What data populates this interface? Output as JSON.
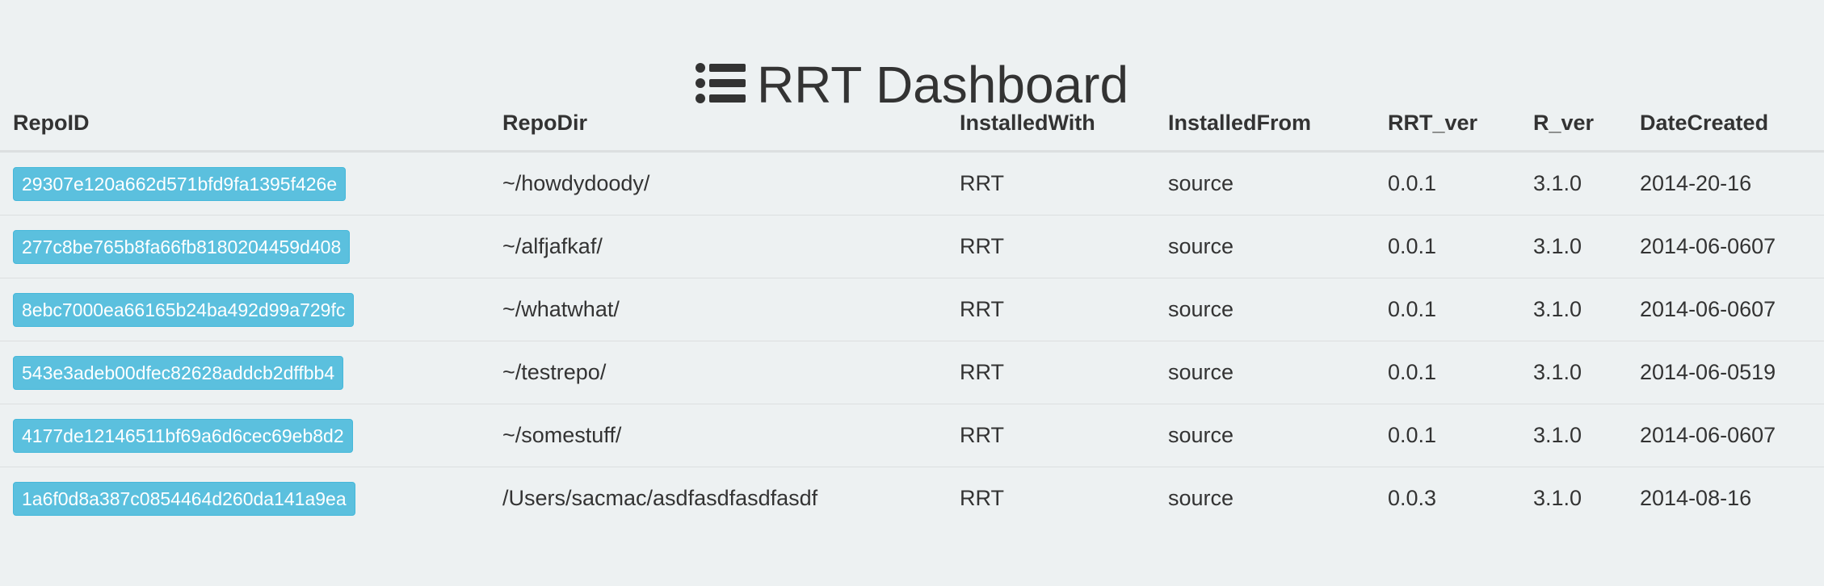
{
  "header": {
    "title": "RRT Dashboard",
    "icon": "list-icon"
  },
  "table": {
    "columns": [
      "RepoID",
      "RepoDir",
      "InstalledWith",
      "InstalledFrom",
      "RRT_ver",
      "R_ver",
      "DateCreated"
    ],
    "rows": [
      {
        "repo_id": "29307e120a662d571bfd9fa1395f426e",
        "repo_dir": "~/howdydoody/",
        "installed_with": "RRT",
        "installed_from": "source",
        "rrt_ver": "0.0.1",
        "r_ver": "3.1.0",
        "date_created": "2014-20-16"
      },
      {
        "repo_id": "277c8be765b8fa66fb8180204459d408",
        "repo_dir": "~/alfjafkaf/",
        "installed_with": "RRT",
        "installed_from": "source",
        "rrt_ver": "0.0.1",
        "r_ver": "3.1.0",
        "date_created": "2014-06-0607"
      },
      {
        "repo_id": "8ebc7000ea66165b24ba492d99a729fc",
        "repo_dir": "~/whatwhat/",
        "installed_with": "RRT",
        "installed_from": "source",
        "rrt_ver": "0.0.1",
        "r_ver": "3.1.0",
        "date_created": "2014-06-0607"
      },
      {
        "repo_id": "543e3adeb00dfec82628addcb2dffbb4",
        "repo_dir": "~/testrepo/",
        "installed_with": "RRT",
        "installed_from": "source",
        "rrt_ver": "0.0.1",
        "r_ver": "3.1.0",
        "date_created": "2014-06-0519"
      },
      {
        "repo_id": "4177de12146511bf69a6d6cec69eb8d2",
        "repo_dir": "~/somestuff/",
        "installed_with": "RRT",
        "installed_from": "source",
        "rrt_ver": "0.0.1",
        "r_ver": "3.1.0",
        "date_created": "2014-06-0607"
      },
      {
        "repo_id": "1a6f0d8a387c0854464d260da141a9ea",
        "repo_dir": "/Users/sacmac/asdfasdfasdfasdf",
        "installed_with": "RRT",
        "installed_from": "source",
        "rrt_ver": "0.0.3",
        "r_ver": "3.1.0",
        "date_created": "2014-08-16"
      }
    ]
  },
  "colors": {
    "background": "#edf1f2",
    "badge": "#5bc0de",
    "text": "#333333"
  }
}
